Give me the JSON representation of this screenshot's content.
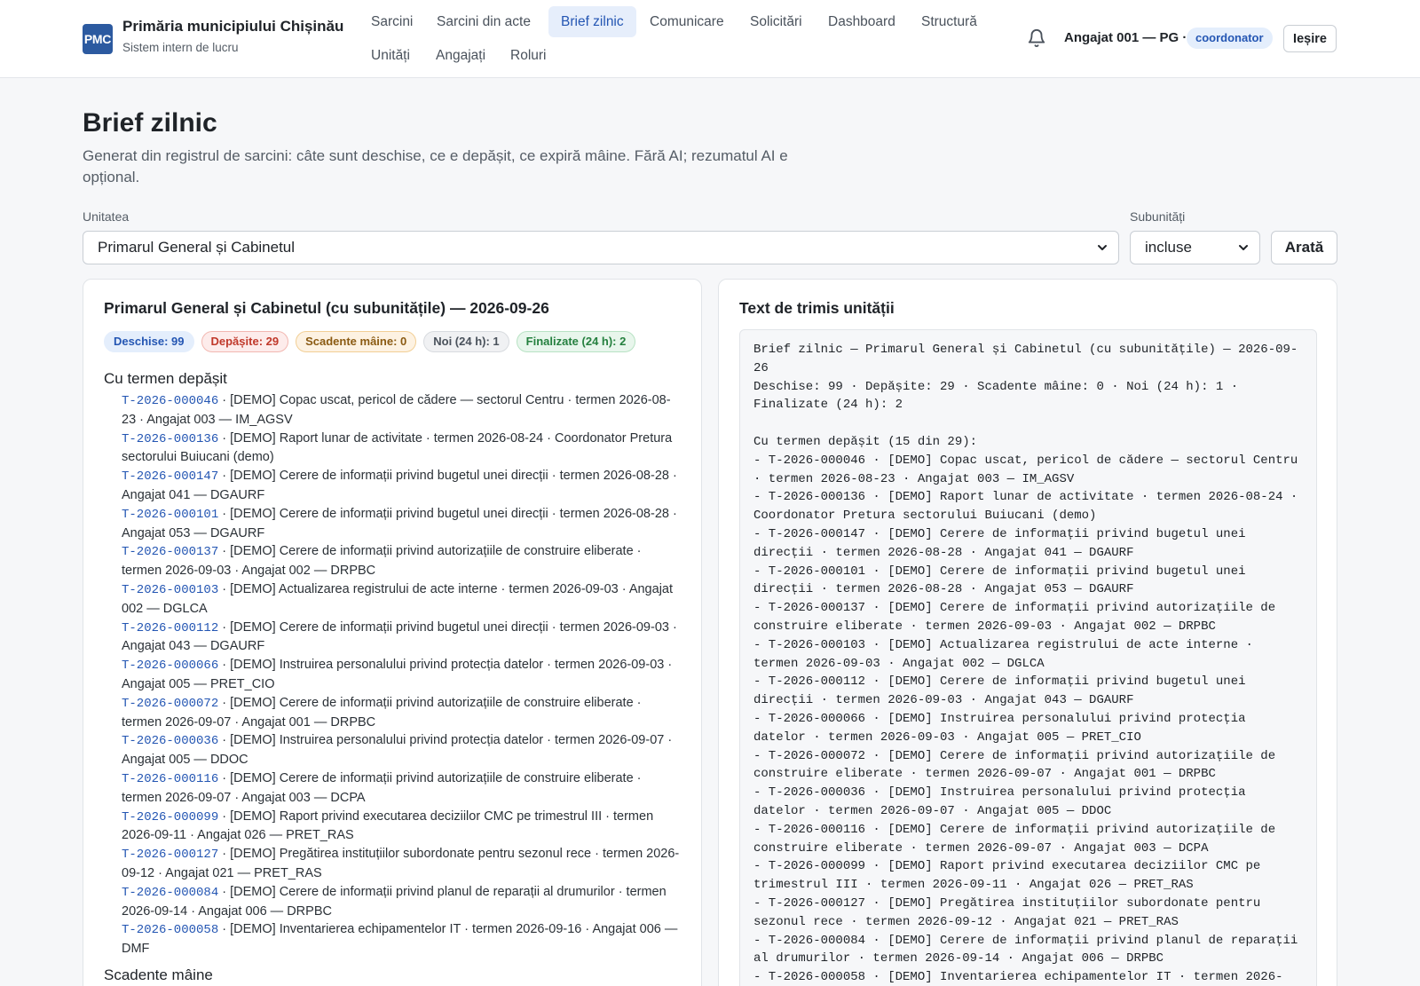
{
  "header": {
    "logo_text": "PMC",
    "title": "Primăria municipiului Chișinău",
    "subtitle": "Sistem intern de lucru",
    "nav": [
      "Sarcini",
      "Sarcini din acte",
      "Brief zilnic",
      "Comunicare",
      "Solicitări",
      "Dashboard",
      "Structură",
      "Unități",
      "Angajați",
      "Roluri"
    ],
    "active_nav": "Brief zilnic",
    "user": "Angajat 001 — PG ·",
    "role": "coordonator",
    "logout": "Ieșire"
  },
  "page": {
    "title": "Brief zilnic",
    "description": "Generat din registrul de sarcini: câte sunt deschise, ce e depășit, ce expiră mâine. Fără AI; rezumatul AI e opțional."
  },
  "filters": {
    "unit_label": "Unitatea",
    "unit_value": "Primarul General și Cabinetul",
    "sub_label": "Subunități",
    "sub_value": "incluse",
    "show_button": "Arată"
  },
  "summary": {
    "title": "Primarul General și Cabinetul (cu subunitățile) — 2026-09-26",
    "badges": {
      "open": "Deschise: 99",
      "overdue": "Depășite: 29",
      "due": "Scadente mâine: 0",
      "new": "Noi (24 h): 1",
      "done": "Finalizate (24 h): 2"
    },
    "overdue_title": "Cu termen depășit",
    "due_title": "Scadente mâine",
    "tasks": [
      {
        "id": "T-2026-000046",
        "text": " · [DEMO] Copac uscat, pericol de cădere — sectorul Centru · termen 2026-08-23 · Angajat 003 — IM_AGSV"
      },
      {
        "id": "T-2026-000136",
        "text": " · [DEMO] Raport lunar de activitate · termen 2026-08-24 · Coordonator Pretura sectorului Buiucani (demo)"
      },
      {
        "id": "T-2026-000147",
        "text": " · [DEMO] Cerere de informații privind bugetul unei direcții · termen 2026-08-28 · Angajat 041 — DGAURF"
      },
      {
        "id": "T-2026-000101",
        "text": " · [DEMO] Cerere de informații privind bugetul unei direcții · termen 2026-08-28 · Angajat 053 — DGAURF"
      },
      {
        "id": "T-2026-000137",
        "text": " · [DEMO] Cerere de informații privind autorizațiile de construire eliberate · termen 2026-09-03 · Angajat 002 — DRPBC"
      },
      {
        "id": "T-2026-000103",
        "text": " · [DEMO] Actualizarea registrului de acte interne · termen 2026-09-03 · Angajat 002 — DGLCA"
      },
      {
        "id": "T-2026-000112",
        "text": " · [DEMO] Cerere de informații privind bugetul unei direcții · termen 2026-09-03 · Angajat 043 — DGAURF"
      },
      {
        "id": "T-2026-000066",
        "text": " · [DEMO] Instruirea personalului privind protecția datelor · termen 2026-09-03 · Angajat 005 — PRET_CIO"
      },
      {
        "id": "T-2026-000072",
        "text": " · [DEMO] Cerere de informații privind autorizațiile de construire eliberate · termen 2026-09-07 · Angajat 001 — DRPBC"
      },
      {
        "id": "T-2026-000036",
        "text": " · [DEMO] Instruirea personalului privind protecția datelor · termen 2026-09-07 · Angajat 005 — DDOC"
      },
      {
        "id": "T-2026-000116",
        "text": " · [DEMO] Cerere de informații privind autorizațiile de construire eliberate · termen 2026-09-07 · Angajat 003 — DCPA"
      },
      {
        "id": "T-2026-000099",
        "text": " · [DEMO] Raport privind executarea deciziilor CMC pe trimestrul III · termen 2026-09-11 · Angajat 026 — PRET_RAS"
      },
      {
        "id": "T-2026-000127",
        "text": " · [DEMO] Pregătirea instituțiilor subordonate pentru sezonul rece · termen 2026-09-12 · Angajat 021 — PRET_RAS"
      },
      {
        "id": "T-2026-000084",
        "text": " · [DEMO] Cerere de informații privind planul de reparații al drumurilor · termen 2026-09-14 · Angajat 006 — DRPBC"
      },
      {
        "id": "T-2026-000058",
        "text": " · [DEMO] Inventarierea echipamentelor IT · termen 2026-09-16 · Angajat 006 — DMF"
      }
    ]
  },
  "text_panel": {
    "title": "Text de trimis unității",
    "content": "Brief zilnic — Primarul General și Cabinetul (cu subunitățile) — 2026-09-26\nDeschise: 99 · Depășite: 29 · Scadente mâine: 0 · Noi (24 h): 1 · Finalizate (24 h): 2\n\nCu termen depășit (15 din 29):\n- T-2026-000046 · [DEMO] Copac uscat, pericol de cădere — sectorul Centru · termen 2026-08-23 · Angajat 003 — IM_AGSV\n- T-2026-000136 · [DEMO] Raport lunar de activitate · termen 2026-08-24 · Coordonator Pretura sectorului Buiucani (demo)\n- T-2026-000147 · [DEMO] Cerere de informații privind bugetul unei direcții · termen 2026-08-28 · Angajat 041 — DGAURF\n- T-2026-000101 · [DEMO] Cerere de informații privind bugetul unei direcții · termen 2026-08-28 · Angajat 053 — DGAURF\n- T-2026-000137 · [DEMO] Cerere de informații privind autorizațiile de construire eliberate · termen 2026-09-03 · Angajat 002 — DRPBC\n- T-2026-000103 · [DEMO] Actualizarea registrului de acte interne · termen 2026-09-03 · Angajat 002 — DGLCA\n- T-2026-000112 · [DEMO] Cerere de informații privind bugetul unei direcții · termen 2026-09-03 · Angajat 043 — DGAURF\n- T-2026-000066 · [DEMO] Instruirea personalului privind protecția datelor · termen 2026-09-03 · Angajat 005 — PRET_CIO\n- T-2026-000072 · [DEMO] Cerere de informații privind autorizațiile de construire eliberate · termen 2026-09-07 · Angajat 001 — DRPBC\n- T-2026-000036 · [DEMO] Instruirea personalului privind protecția datelor · termen 2026-09-07 · Angajat 005 — DDOC\n- T-2026-000116 · [DEMO] Cerere de informații privind autorizațiile de construire eliberate · termen 2026-09-07 · Angajat 003 — DCPA\n- T-2026-000099 · [DEMO] Raport privind executarea deciziilor CMC pe trimestrul III · termen 2026-09-11 · Angajat 026 — PRET_RAS\n- T-2026-000127 · [DEMO] Pregătirea instituțiilor subordonate pentru sezonul rece · termen 2026-09-12 · Angajat 021 — PRET_RAS\n- T-2026-000084 · [DEMO] Cerere de informații privind planul de reparații al drumurilor · termen 2026-09-14 · Angajat 006 — DRPBC\n- T-2026-000058 · [DEMO] Inventarierea echipamentelor IT · termen 2026-"
  }
}
